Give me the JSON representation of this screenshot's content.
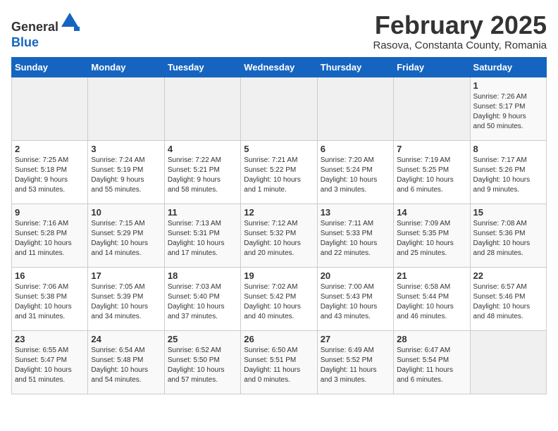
{
  "header": {
    "logo_line1": "General",
    "logo_line2": "Blue",
    "month_title": "February 2025",
    "subtitle": "Rasova, Constanta County, Romania"
  },
  "days_of_week": [
    "Sunday",
    "Monday",
    "Tuesday",
    "Wednesday",
    "Thursday",
    "Friday",
    "Saturday"
  ],
  "weeks": [
    [
      {
        "day": "",
        "info": ""
      },
      {
        "day": "",
        "info": ""
      },
      {
        "day": "",
        "info": ""
      },
      {
        "day": "",
        "info": ""
      },
      {
        "day": "",
        "info": ""
      },
      {
        "day": "",
        "info": ""
      },
      {
        "day": "1",
        "info": "Sunrise: 7:26 AM\nSunset: 5:17 PM\nDaylight: 9 hours\nand 50 minutes."
      }
    ],
    [
      {
        "day": "2",
        "info": "Sunrise: 7:25 AM\nSunset: 5:18 PM\nDaylight: 9 hours\nand 53 minutes."
      },
      {
        "day": "3",
        "info": "Sunrise: 7:24 AM\nSunset: 5:19 PM\nDaylight: 9 hours\nand 55 minutes."
      },
      {
        "day": "4",
        "info": "Sunrise: 7:22 AM\nSunset: 5:21 PM\nDaylight: 9 hours\nand 58 minutes."
      },
      {
        "day": "5",
        "info": "Sunrise: 7:21 AM\nSunset: 5:22 PM\nDaylight: 10 hours\nand 1 minute."
      },
      {
        "day": "6",
        "info": "Sunrise: 7:20 AM\nSunset: 5:24 PM\nDaylight: 10 hours\nand 3 minutes."
      },
      {
        "day": "7",
        "info": "Sunrise: 7:19 AM\nSunset: 5:25 PM\nDaylight: 10 hours\nand 6 minutes."
      },
      {
        "day": "8",
        "info": "Sunrise: 7:17 AM\nSunset: 5:26 PM\nDaylight: 10 hours\nand 9 minutes."
      }
    ],
    [
      {
        "day": "9",
        "info": "Sunrise: 7:16 AM\nSunset: 5:28 PM\nDaylight: 10 hours\nand 11 minutes."
      },
      {
        "day": "10",
        "info": "Sunrise: 7:15 AM\nSunset: 5:29 PM\nDaylight: 10 hours\nand 14 minutes."
      },
      {
        "day": "11",
        "info": "Sunrise: 7:13 AM\nSunset: 5:31 PM\nDaylight: 10 hours\nand 17 minutes."
      },
      {
        "day": "12",
        "info": "Sunrise: 7:12 AM\nSunset: 5:32 PM\nDaylight: 10 hours\nand 20 minutes."
      },
      {
        "day": "13",
        "info": "Sunrise: 7:11 AM\nSunset: 5:33 PM\nDaylight: 10 hours\nand 22 minutes."
      },
      {
        "day": "14",
        "info": "Sunrise: 7:09 AM\nSunset: 5:35 PM\nDaylight: 10 hours\nand 25 minutes."
      },
      {
        "day": "15",
        "info": "Sunrise: 7:08 AM\nSunset: 5:36 PM\nDaylight: 10 hours\nand 28 minutes."
      }
    ],
    [
      {
        "day": "16",
        "info": "Sunrise: 7:06 AM\nSunset: 5:38 PM\nDaylight: 10 hours\nand 31 minutes."
      },
      {
        "day": "17",
        "info": "Sunrise: 7:05 AM\nSunset: 5:39 PM\nDaylight: 10 hours\nand 34 minutes."
      },
      {
        "day": "18",
        "info": "Sunrise: 7:03 AM\nSunset: 5:40 PM\nDaylight: 10 hours\nand 37 minutes."
      },
      {
        "day": "19",
        "info": "Sunrise: 7:02 AM\nSunset: 5:42 PM\nDaylight: 10 hours\nand 40 minutes."
      },
      {
        "day": "20",
        "info": "Sunrise: 7:00 AM\nSunset: 5:43 PM\nDaylight: 10 hours\nand 43 minutes."
      },
      {
        "day": "21",
        "info": "Sunrise: 6:58 AM\nSunset: 5:44 PM\nDaylight: 10 hours\nand 46 minutes."
      },
      {
        "day": "22",
        "info": "Sunrise: 6:57 AM\nSunset: 5:46 PM\nDaylight: 10 hours\nand 48 minutes."
      }
    ],
    [
      {
        "day": "23",
        "info": "Sunrise: 6:55 AM\nSunset: 5:47 PM\nDaylight: 10 hours\nand 51 minutes."
      },
      {
        "day": "24",
        "info": "Sunrise: 6:54 AM\nSunset: 5:48 PM\nDaylight: 10 hours\nand 54 minutes."
      },
      {
        "day": "25",
        "info": "Sunrise: 6:52 AM\nSunset: 5:50 PM\nDaylight: 10 hours\nand 57 minutes."
      },
      {
        "day": "26",
        "info": "Sunrise: 6:50 AM\nSunset: 5:51 PM\nDaylight: 11 hours\nand 0 minutes."
      },
      {
        "day": "27",
        "info": "Sunrise: 6:49 AM\nSunset: 5:52 PM\nDaylight: 11 hours\nand 3 minutes."
      },
      {
        "day": "28",
        "info": "Sunrise: 6:47 AM\nSunset: 5:54 PM\nDaylight: 11 hours\nand 6 minutes."
      },
      {
        "day": "",
        "info": ""
      }
    ]
  ]
}
